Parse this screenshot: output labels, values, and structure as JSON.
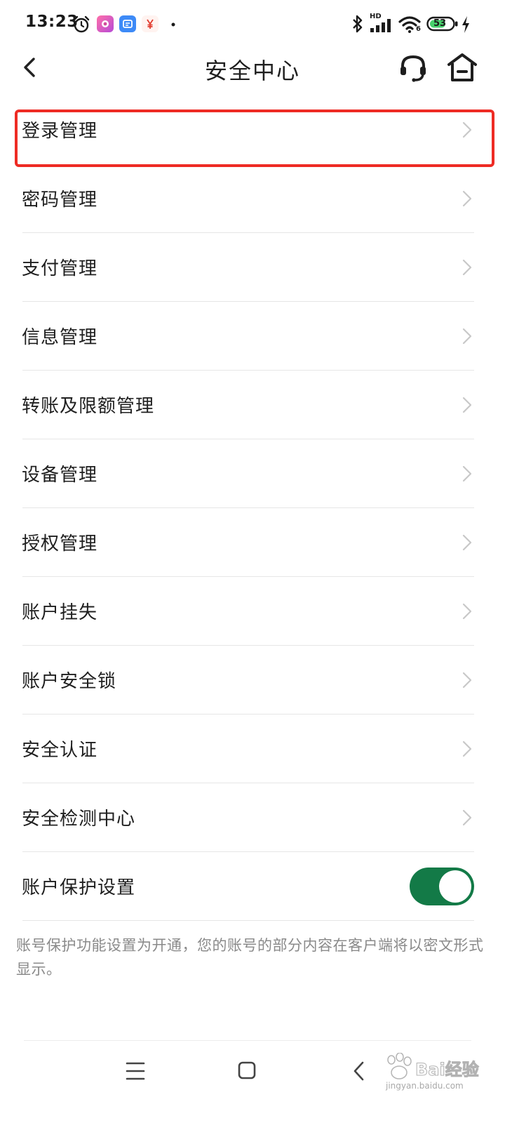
{
  "status_bar": {
    "time": "13:23",
    "network_label": "HD",
    "wifi_label": "6",
    "battery_level": "53"
  },
  "header": {
    "title": "安全中心"
  },
  "menu": {
    "items": [
      {
        "label": "登录管理"
      },
      {
        "label": "密码管理"
      },
      {
        "label": "支付管理"
      },
      {
        "label": "信息管理"
      },
      {
        "label": "转账及限额管理"
      },
      {
        "label": "设备管理"
      },
      {
        "label": "授权管理"
      },
      {
        "label": "账户挂失"
      },
      {
        "label": "账户安全锁"
      },
      {
        "label": "安全认证"
      },
      {
        "label": "安全检测中心"
      }
    ],
    "toggle_item": {
      "label": "账户保护设置",
      "enabled": true
    }
  },
  "note": "账号保护功能设置为开通，您的账号的部分内容在客户端将以密文形式显示。",
  "watermark": {
    "text": "Bai经验",
    "sub": "jingyan.baidu.com"
  },
  "colors": {
    "accent": "#137a47",
    "highlight": "#ee2b24"
  }
}
